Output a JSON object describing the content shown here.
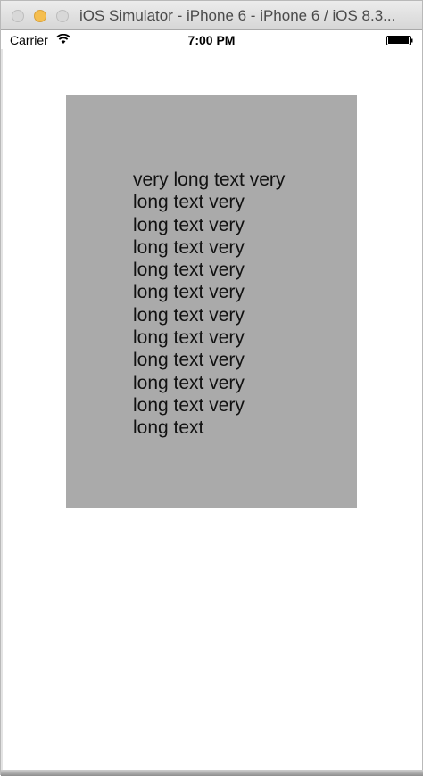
{
  "window": {
    "title": "iOS Simulator - iPhone 6 - iPhone 6 / iOS 8.3..."
  },
  "status_bar": {
    "carrier": "Carrier",
    "time": "7:00 PM",
    "wifi_icon": "wifi-icon",
    "battery_icon": "battery-icon"
  },
  "content": {
    "box_color": "#aaaaaa",
    "label_lines": [
      "very long text very",
      "long text very",
      "long text very",
      "long text very",
      "long text very",
      "long text very",
      "long text very",
      "long text very",
      "long text very",
      "long text very",
      "long text very",
      "long text"
    ]
  }
}
